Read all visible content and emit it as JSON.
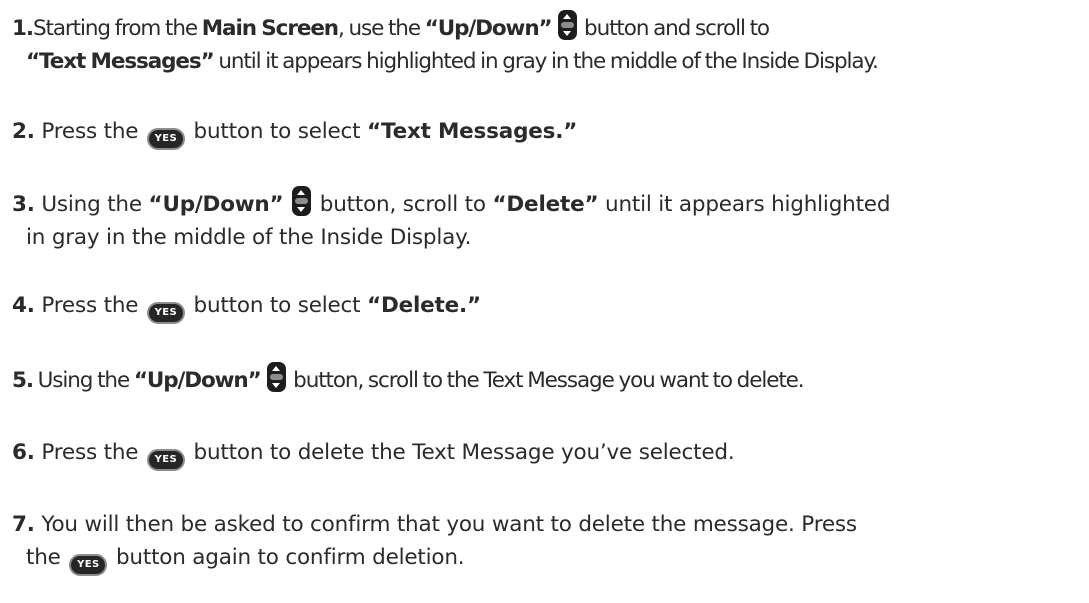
{
  "steps": [
    {
      "num": "1.",
      "t1": "Starting from the ",
      "b1": "Main Screen",
      "t2": ", use the ",
      "b2": "“Up/Down”",
      "t3": " button and scroll to",
      "b3": "“Text Messages”",
      "t4": " until it appears highlighted in gray in the middle of the Inside Display."
    },
    {
      "num": "2.",
      "t1": " Press the ",
      "t2": " button to select ",
      "b1": "“Text Messages.”"
    },
    {
      "num": "3.",
      "t1": " Using the ",
      "b1": "“Up/Down”",
      "t2": " button, scroll to ",
      "b2": "“Delete”",
      "t3": " until it appears highlighted",
      "t4": "in gray in the middle of the Inside Display."
    },
    {
      "num": "4.",
      "t1": " Press the ",
      "t2": " button to select ",
      "b1": "“Delete.”"
    },
    {
      "num": "5.",
      "t1": " Using the ",
      "b1": "“Up/Down”",
      "t2": " button, scroll to the Text Message you want to delete."
    },
    {
      "num": "6.",
      "t1": " Press the ",
      "t2": " button to delete the Text Message you’ve selected."
    },
    {
      "num": "7.",
      "t1": " You will then be asked to confirm that you want to delete the message.  Press",
      "t2": "the ",
      "t3": " button again to confirm deletion."
    }
  ],
  "icons": {
    "yes_label": "YES",
    "updown": "up-down-button-icon",
    "yes": "yes-button-icon"
  }
}
